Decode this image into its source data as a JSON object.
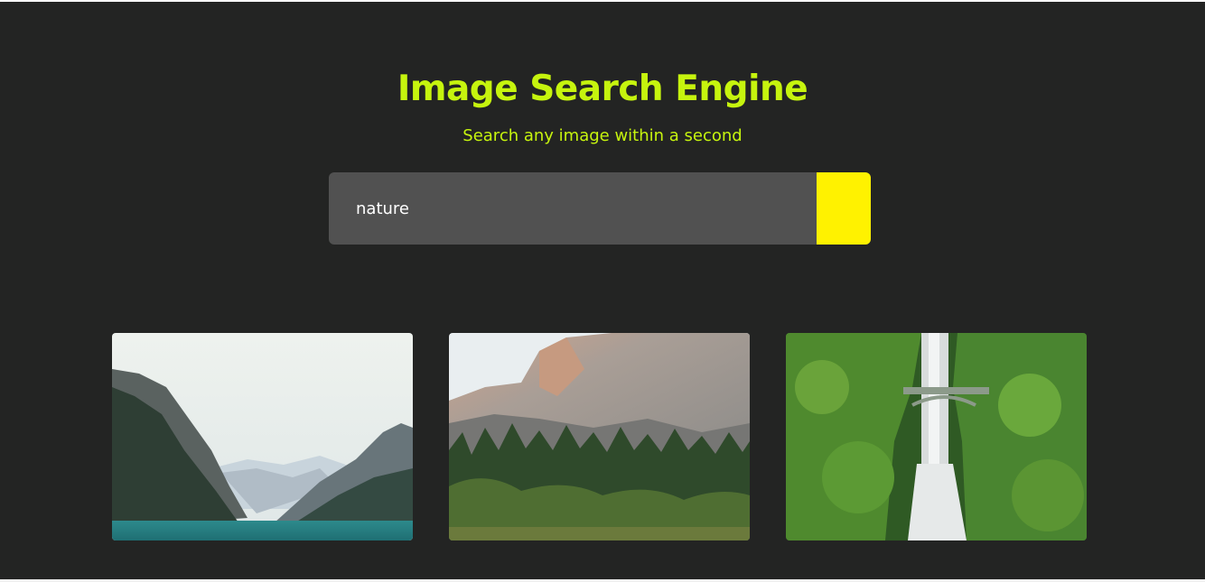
{
  "header": {
    "title": "Image Search Engine",
    "subtitle": "Search any image within a second"
  },
  "search": {
    "value": "nature",
    "placeholder": "",
    "button_color": "#fff200"
  },
  "results": [
    {
      "subject": "mountain lake"
    },
    {
      "subject": "granite cliff forest"
    },
    {
      "subject": "waterfall with bridge"
    }
  ],
  "colors": {
    "background": "#232423",
    "accent": "#c6f40e",
    "input_background": "#515151"
  }
}
